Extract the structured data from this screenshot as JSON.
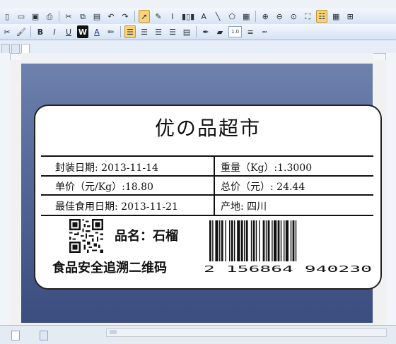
{
  "menubar": {
    "items": [
      "",
      "",
      "",
      "",
      ""
    ]
  },
  "toolbar": {
    "bold": "B",
    "italic": "I",
    "underline": "U",
    "word_art": "W",
    "font_color": "A",
    "text_tool": "A",
    "font_size": "1.0"
  },
  "document_tabs": [
    {
      "label": "",
      "active": false
    },
    {
      "label": "",
      "active": false
    },
    {
      "label": "",
      "active": true
    }
  ],
  "label": {
    "title": "优の品超市",
    "rows": [
      {
        "left": "封装日期: 2013-11-14",
        "right": "重量（Kg）:1.3000"
      },
      {
        "left": "单价（元/Kg）:18.80",
        "right": "总价（元）: 24.44"
      },
      {
        "left": "最佳食用日期: 2013-11-21",
        "right": "产地: 四川"
      }
    ],
    "product": "品名：石榴",
    "trace_label": "食品安全追溯二维码",
    "barcode_number": "2  156864  940230"
  },
  "statusbar": {
    "sheet_tabs": [
      "",
      ""
    ]
  },
  "colors": {
    "paper_top": "#6e82ad",
    "paper_bottom": "#3b4d7f",
    "active_tool": "#f8d27a"
  }
}
